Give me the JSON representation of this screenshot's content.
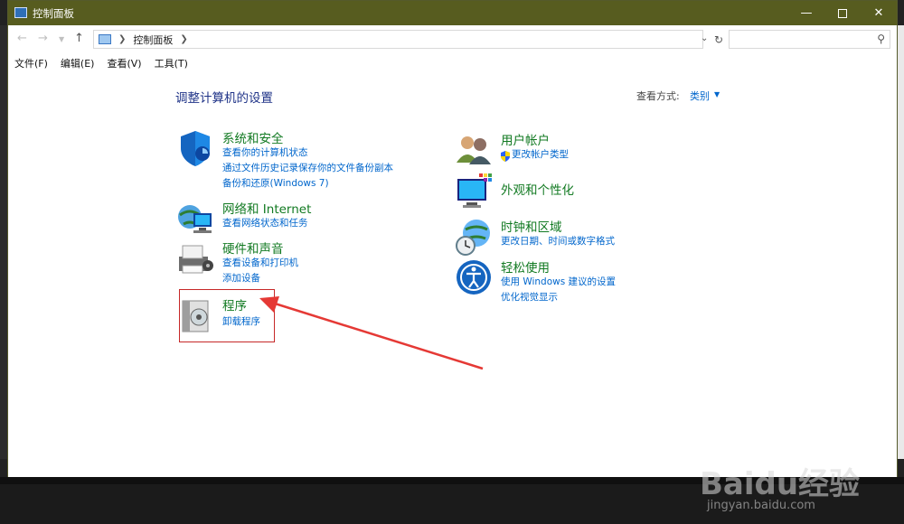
{
  "window": {
    "title": "控制面板"
  },
  "address": {
    "path": "控制面板",
    "search_placeholder": ""
  },
  "menu": [
    "文件(F)",
    "编辑(E)",
    "查看(V)",
    "工具(T)"
  ],
  "page": {
    "title": "调整计算机的设置",
    "view_label": "查看方式:",
    "view_value": "类别"
  },
  "categories_left": [
    {
      "title": "系统和安全",
      "links": [
        "查看你的计算机状态",
        "通过文件历史记录保存你的文件备份副本",
        "备份和还原(Windows 7)"
      ]
    },
    {
      "title": "网络和 Internet",
      "links": [
        "查看网络状态和任务"
      ]
    },
    {
      "title": "硬件和声音",
      "links": [
        "查看设备和打印机",
        "添加设备"
      ]
    },
    {
      "title": "程序",
      "links": [
        "卸载程序"
      ]
    }
  ],
  "categories_right": [
    {
      "title": "用户帐户",
      "links": [
        "更改帐户类型"
      ]
    },
    {
      "title": "外观和个性化",
      "links": []
    },
    {
      "title": "时钟和区域",
      "links": [
        "更改日期、时间或数字格式"
      ]
    },
    {
      "title": "轻松使用",
      "links": [
        "使用 Windows 建议的设置",
        "优化视觉显示"
      ]
    }
  ],
  "watermark": {
    "brand": "Baidu经验",
    "url": "jingyan.baidu.com"
  },
  "colors": {
    "titlebar": "#575c1f",
    "category_title": "#127a22",
    "link": "#0066cc",
    "annotation": "#e53935"
  }
}
